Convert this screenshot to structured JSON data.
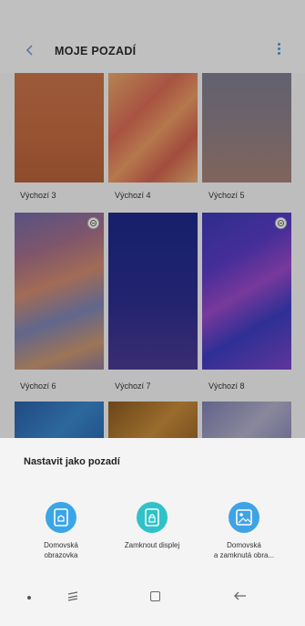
{
  "header": {
    "title": "MOJE POZADÍ"
  },
  "wallpapers": [
    {
      "label": "Výchozí 3"
    },
    {
      "label": "Výchozí 4"
    },
    {
      "label": "Výchozí 5"
    },
    {
      "label": "Výchozí 6"
    },
    {
      "label": "Výchozí 7"
    },
    {
      "label": "Výchozí 8"
    }
  ],
  "sheet": {
    "title": "Nastavit jako pozadí",
    "options": [
      {
        "label_line1": "Domovská",
        "label_line2": "obrazovka"
      },
      {
        "label_line1": "Zamknout displej",
        "label_line2": ""
      },
      {
        "label_line1": "Domovská",
        "label_line2": "a zamknutá obra..."
      }
    ]
  },
  "colors": {
    "accent": "#4a90e2",
    "home_icon": "#3aa6e8",
    "lock_icon": "#2fc2c8",
    "both_icon": "#3fa3e6"
  }
}
